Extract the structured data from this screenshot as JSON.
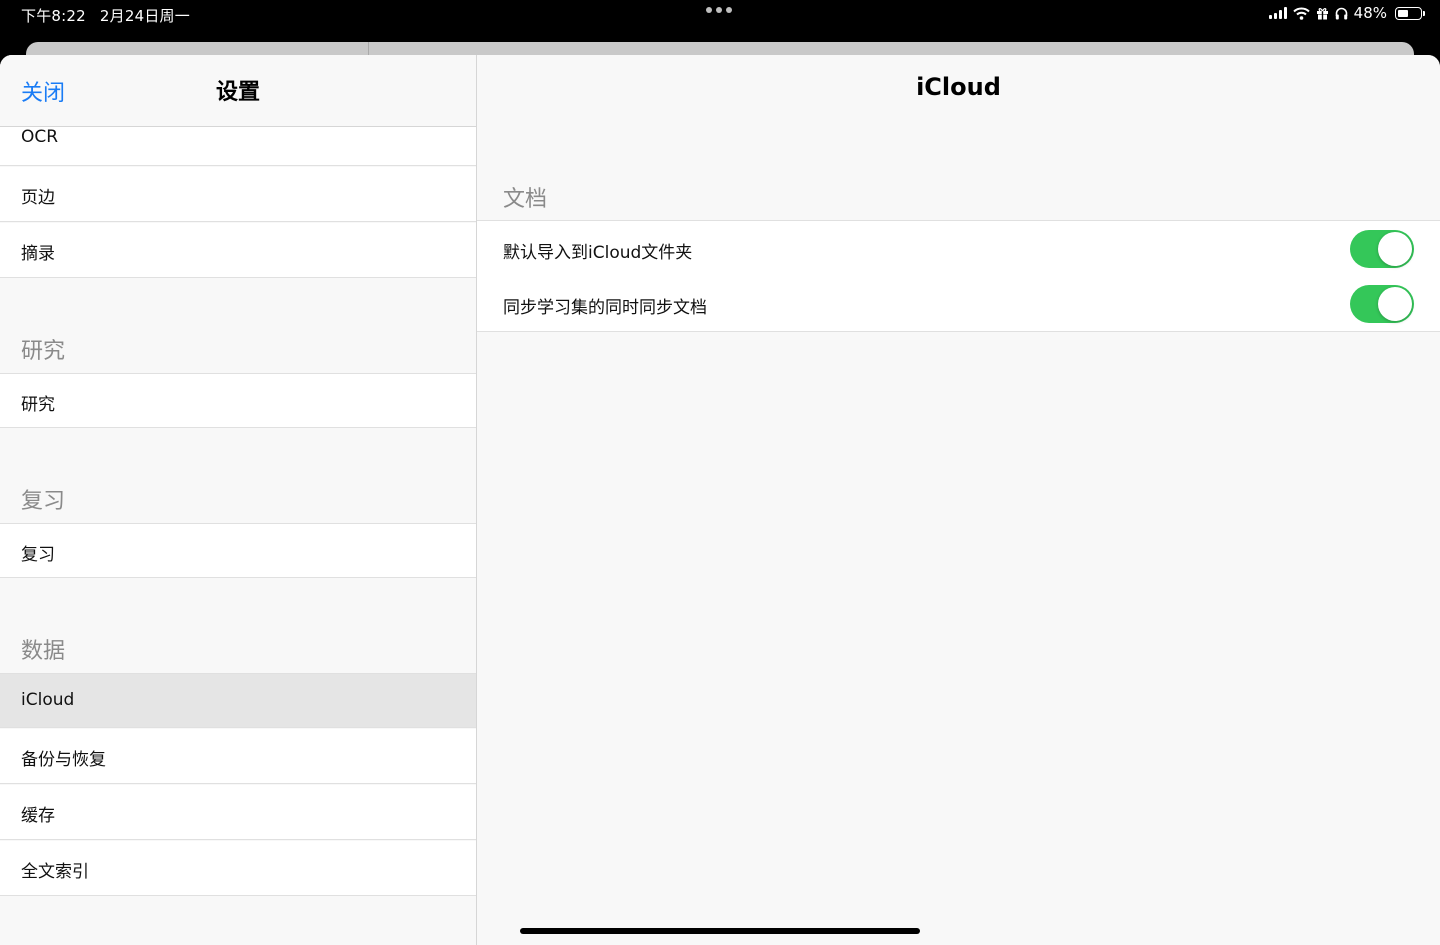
{
  "status_bar": {
    "time": "下午8:22",
    "date": "2月24日周一",
    "battery_text": "48%",
    "battery_level": 0.48,
    "icons": [
      "signal-icon",
      "wifi-icon",
      "gift-icon",
      "headphones-icon",
      "battery-icon"
    ]
  },
  "sidebar": {
    "close_label": "关闭",
    "title": "设置",
    "rows_top": [
      "OCR",
      "页边",
      "摘录"
    ],
    "sections": [
      {
        "header": "研究",
        "items": [
          "研究"
        ]
      },
      {
        "header": "复习",
        "items": [
          "复习"
        ]
      },
      {
        "header": "数据",
        "items": [
          "iCloud",
          "备份与恢复",
          "缓存",
          "全文索引"
        ]
      }
    ],
    "selected": "iCloud"
  },
  "detail": {
    "title": "iCloud",
    "section_header": "文档",
    "settings": [
      {
        "label": "默认导入到iCloud文件夹",
        "enabled": true
      },
      {
        "label": "同步学习集的同时同步文档",
        "enabled": true
      }
    ]
  },
  "colors": {
    "accent": "#1a7cf5",
    "toggle_on": "#34c759",
    "selected_row": "#e5e5e5",
    "background": "#f8f8f8"
  }
}
